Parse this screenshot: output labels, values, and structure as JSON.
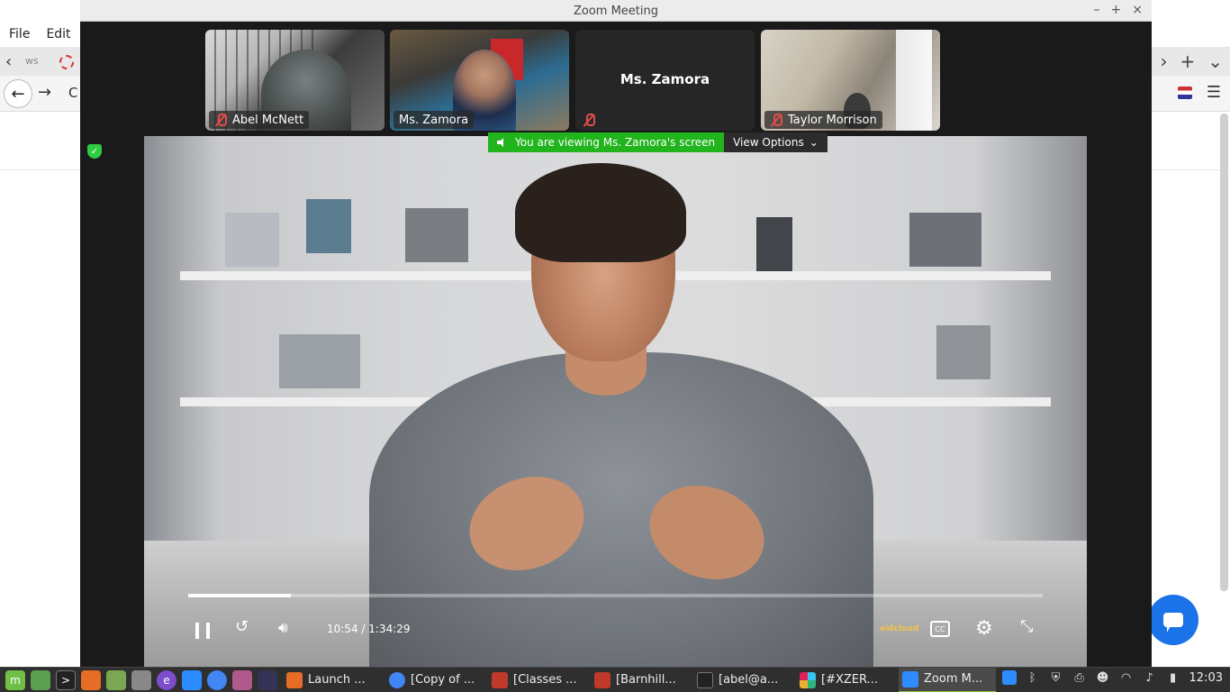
{
  "background_browser": {
    "menu": [
      "File",
      "Edit"
    ],
    "tab_text": "ws"
  },
  "zoom": {
    "window_title": "Zoom Meeting",
    "participants": [
      {
        "name": "Abel McNett"
      },
      {
        "name": "Ms. Zamora"
      },
      {
        "name": "Ms. Zamora"
      },
      {
        "name": "Taylor Morrison"
      }
    ],
    "share_banner": {
      "text": "You are viewing Ms. Zamora's screen",
      "view_options": "View Options"
    },
    "video": {
      "current_time": "10:54",
      "separator": "/",
      "duration": "1:34:29",
      "progress_fraction": 0.12,
      "provider_logo": "aidcloud",
      "cc_label": "CC"
    }
  },
  "taskbar": {
    "tasks": [
      {
        "label": "Launch ...",
        "color": "#e66d26",
        "icon": "firefox-icon"
      },
      {
        "label": "[Copy of ...",
        "color": "#4285f4",
        "icon": "chrome-icon"
      },
      {
        "label": "[Classes ...",
        "color": "#c0392b",
        "icon": "chart-app-icon"
      },
      {
        "label": "[Barnhill...",
        "color": "#c0392b",
        "icon": "chart-app-icon"
      },
      {
        "label": "[abel@a...",
        "color": "#333333",
        "icon": "terminal-icon"
      },
      {
        "label": "[#XZER...",
        "color": "#e01e5a",
        "icon": "slack-icon"
      },
      {
        "label": "Zoom M...",
        "color": "#2d8cff",
        "icon": "zoom-icon"
      }
    ],
    "clock": "12:03"
  }
}
